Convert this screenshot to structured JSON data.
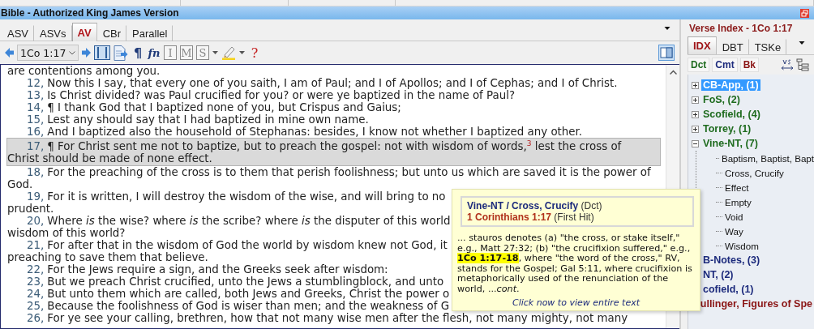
{
  "window": {
    "title": "Bible - Authorized King James Version"
  },
  "bible": {
    "tabs": [
      {
        "label": "ASV",
        "selected": false
      },
      {
        "label": "ASVs",
        "selected": false
      },
      {
        "label": "AV",
        "selected": true
      },
      {
        "label": "CBr",
        "selected": false
      },
      {
        "label": "Parallel",
        "selected": false
      }
    ],
    "toolbar": {
      "reference": "1Co 1:17",
      "buttons": [
        {
          "kind": "columns"
        },
        {
          "kind": "document"
        },
        {
          "kind": "pilcrow",
          "label": "¶"
        },
        {
          "kind": "footnote",
          "label": "fn"
        },
        {
          "kind": "boxed",
          "label": "I"
        },
        {
          "kind": "boxed",
          "label": "M"
        },
        {
          "kind": "boxed",
          "label": "S",
          "menu": true
        },
        {
          "kind": "highlighter",
          "menu": true
        },
        {
          "kind": "help",
          "label": "?"
        }
      ]
    },
    "verses": [
      {
        "lines": [
          "are contentions among you."
        ],
        "selected": false
      },
      {
        "number": "12,",
        "lines": [
          "Now this I say, that every one of you saith, I am of Paul; and I of Apollos; and I of Cephas; and I of Christ."
        ],
        "selected": false
      },
      {
        "number": "13,",
        "lines": [
          "Is Christ divided? was Paul crucified for you? or were ye baptized in the name of Paul?"
        ],
        "selected": false
      },
      {
        "number": "14,",
        "lines": [
          "¶ I thank God that I baptized none of you, but Crispus and Gaius;"
        ],
        "selected": false
      },
      {
        "number": "15,",
        "lines": [
          "Lest any should say that I had baptized in mine own name."
        ],
        "selected": false
      },
      {
        "number": "16,",
        "lines": [
          "And I baptized also the household of Stephanas: besides, I know not whether I baptized any other."
        ],
        "selected": false
      },
      {
        "number": "17,",
        "lines": [
          "¶ For Christ sent me not to baptize, but to preach the gospel: not with wisdom of words,$^{3}$ lest the cross of",
          "Christ should be made of none effect."
        ],
        "selected": true
      },
      {
        "number": "18,",
        "lines": [
          "For the preaching of the cross is to them that perish foolishness; but unto us which are saved it is the power of",
          "God."
        ],
        "selected": false
      },
      {
        "number": "19,",
        "lines": [
          "For it is written, I will destroy the wisdom of the wise, and will bring to no",
          "prudent."
        ],
        "selected": false
      },
      {
        "number": "20,",
        "lines": [
          "Where *is* the wise? where *is* the scribe? where *is* the disputer of this world",
          "wisdom of this world?"
        ],
        "selected": false
      },
      {
        "number": "21,",
        "lines": [
          "For after that in the wisdom of God the world by wisdom knew not God, it",
          "preaching to save them that believe."
        ],
        "selected": false
      },
      {
        "number": "22,",
        "lines": [
          "For the Jews require a sign, and the Greeks seek after wisdom:"
        ],
        "selected": false
      },
      {
        "number": "23,",
        "lines": [
          "But we preach Christ crucified, unto the Jews a stumblingblock, and unto"
        ],
        "selected": false
      },
      {
        "number": "24,",
        "lines": [
          "But unto them which are called, both Jews and Greeks, Christ the power o"
        ],
        "selected": false
      },
      {
        "number": "25,",
        "lines": [
          "Because the foolishness of God is wiser than men; and the weakness of G"
        ],
        "selected": false
      },
      {
        "number": "26,",
        "lines": [
          "For ye see your calling, brethren, how that not many wise men after the flesh, not many mighty, not many"
        ],
        "selected": false
      }
    ]
  },
  "verse_index": {
    "title": "Verse Index - 1Co 1:17",
    "tabs": [
      {
        "label": "IDX",
        "selected": true
      },
      {
        "label": "DBT",
        "selected": false
      },
      {
        "label": "TSKe",
        "selected": false
      }
    ],
    "filters": [
      {
        "label": "Dct",
        "color": "#1e6b1e"
      },
      {
        "label": "Cmt",
        "color": "#1c2a7c"
      },
      {
        "label": "Bk",
        "color": "#8a1414"
      }
    ],
    "tree": [
      {
        "label": "CB-App, (1)",
        "selected": true,
        "expanded": false
      },
      {
        "label": "FoS, (2)",
        "color": "#1e6b1e",
        "selected": false,
        "expanded": false
      },
      {
        "label": "Scofield, (4)",
        "color": "#1e6b1e",
        "selected": false,
        "expanded": false
      },
      {
        "label": "Torrey, (1)",
        "color": "#1e6b1e",
        "selected": false,
        "expanded": false
      },
      {
        "label": "Vine-NT, (7)",
        "color": "#1e6b1e",
        "selected": false,
        "expanded": true,
        "children": [
          {
            "label": "Baptism, Baptist, Bapt"
          },
          {
            "label": "Cross, Crucify"
          },
          {
            "label": "Effect"
          },
          {
            "label": "Empty"
          },
          {
            "label": "Void"
          },
          {
            "label": "Way"
          },
          {
            "label": "Wisdom"
          }
        ]
      },
      {
        "label": "B-Notes, (3)",
        "color": "#1c2a7c",
        "selected": false,
        "expanded": false
      },
      {
        "label": "NT, (2)",
        "color": "#1c2a7c",
        "selected": false,
        "expanded": false
      },
      {
        "label": "cofield, (1)",
        "color": "#1c2a7c",
        "selected": false,
        "expanded": false
      },
      {
        "label": "ullinger, Figures of Spe",
        "color": "#8a1414",
        "selected": false,
        "expanded": false
      }
    ]
  },
  "popup": {
    "heading": "**Vine-NT / Cross, Crucify** (Dct)",
    "reference": "**1 Corinthians 1:17** (First Hit)",
    "body": "... stauros denotes (a) \"the cross, or stake itself,\" e.g., Matt 27:32; (b) \"the crucifixion suffered,\" e.g., **1Co 1:17-18**, where \"the word of the cross,\" RV, stands for the Gospel; Gal 5:11, where crucifixion is metaphorically used of the renunciation of the world, ...*cont*.",
    "link": "Click now to view entire text"
  }
}
